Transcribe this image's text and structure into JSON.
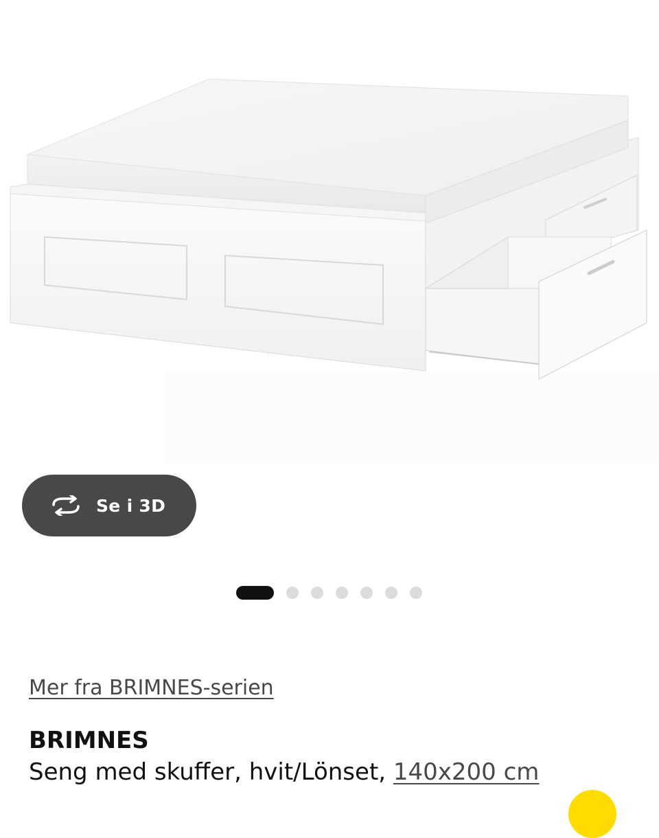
{
  "product_image": {
    "alt": "BRIMNES"
  },
  "view_3d": {
    "label": "Se i 3D",
    "icon": "rotate-3d-icon"
  },
  "carousel": {
    "total": 7,
    "active_index": 0
  },
  "series_link": {
    "label": "Mer fra BRIMNES-serien"
  },
  "product": {
    "name": "BRIMNES",
    "description": "Seng med skuffer, hvit/Lönset, ",
    "size": "140x200 cm"
  },
  "colors": {
    "button_bg": "#484848",
    "dot_active": "#111111",
    "dot_inactive": "#dcdcdc",
    "accent_yellow": "#ffdb00"
  }
}
